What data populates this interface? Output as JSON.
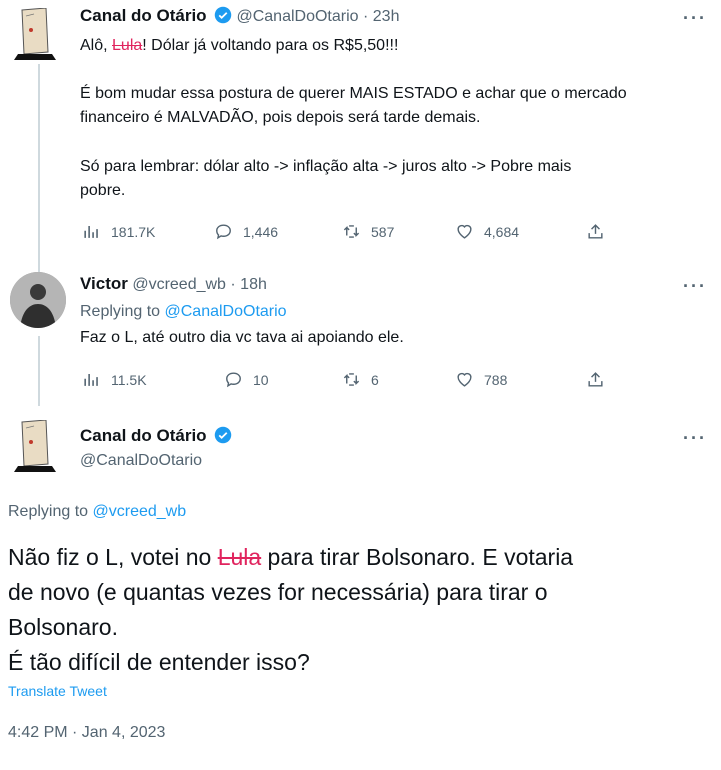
{
  "tweet1": {
    "name": "Canal do Otário",
    "handle": "@CanalDoOtario",
    "time": "23h",
    "line1_pre": "Alô, ",
    "line1_strike": "Lula",
    "line1_post": "! Dólar já voltando para os R$5,50!!!",
    "para2_l1": "É bom mudar essa postura de querer MAIS ESTADO e achar que o mercado",
    "para2_l2": "financeiro é MALVADÃO, pois depois será tarde demais.",
    "para3_l1": "Só para lembrar: dólar alto -> inflação alta -> juros alto -> Pobre mais",
    "para3_l2": "pobre.",
    "views": "181.7K",
    "replies": "1,446",
    "retweets": "587",
    "likes": "4,684"
  },
  "tweet2": {
    "name": "Victor",
    "handle": "@vcreed_wb",
    "time": "18h",
    "replying_label": "Replying to ",
    "replying_handle": "@CanalDoOtario",
    "text": "Faz o L, até outro dia vc tava ai apoiando ele.",
    "views": "11.5K",
    "replies": "10",
    "retweets": "6",
    "likes": "788"
  },
  "tweet3": {
    "name": "Canal do Otário",
    "handle": "@CanalDoOtario",
    "replying_label": "Replying to ",
    "replying_handle": "@vcreed_wb",
    "l1_pre": "Não fiz o L, votei no ",
    "l1_strike": "Lula",
    "l1_post": " para tirar Bolsonaro. E votaria",
    "l2": "de novo (e quantas vezes for necessária) para tirar o",
    "l3": "Bolsonaro.",
    "l4": "É tão difícil de entender isso?",
    "translate": "Translate Tweet",
    "timestamp": "4:42 PM · Jan 4, 2023"
  },
  "separator": " · ",
  "more_glyph": "···",
  "colors": {
    "accent": "#1d9bf0",
    "strike": "#e0245e",
    "muted": "#536471",
    "line": "#cfd9de"
  },
  "icons": [
    "views-icon",
    "reply-icon",
    "retweet-icon",
    "like-icon",
    "share-icon",
    "verified-icon",
    "more-icon"
  ]
}
